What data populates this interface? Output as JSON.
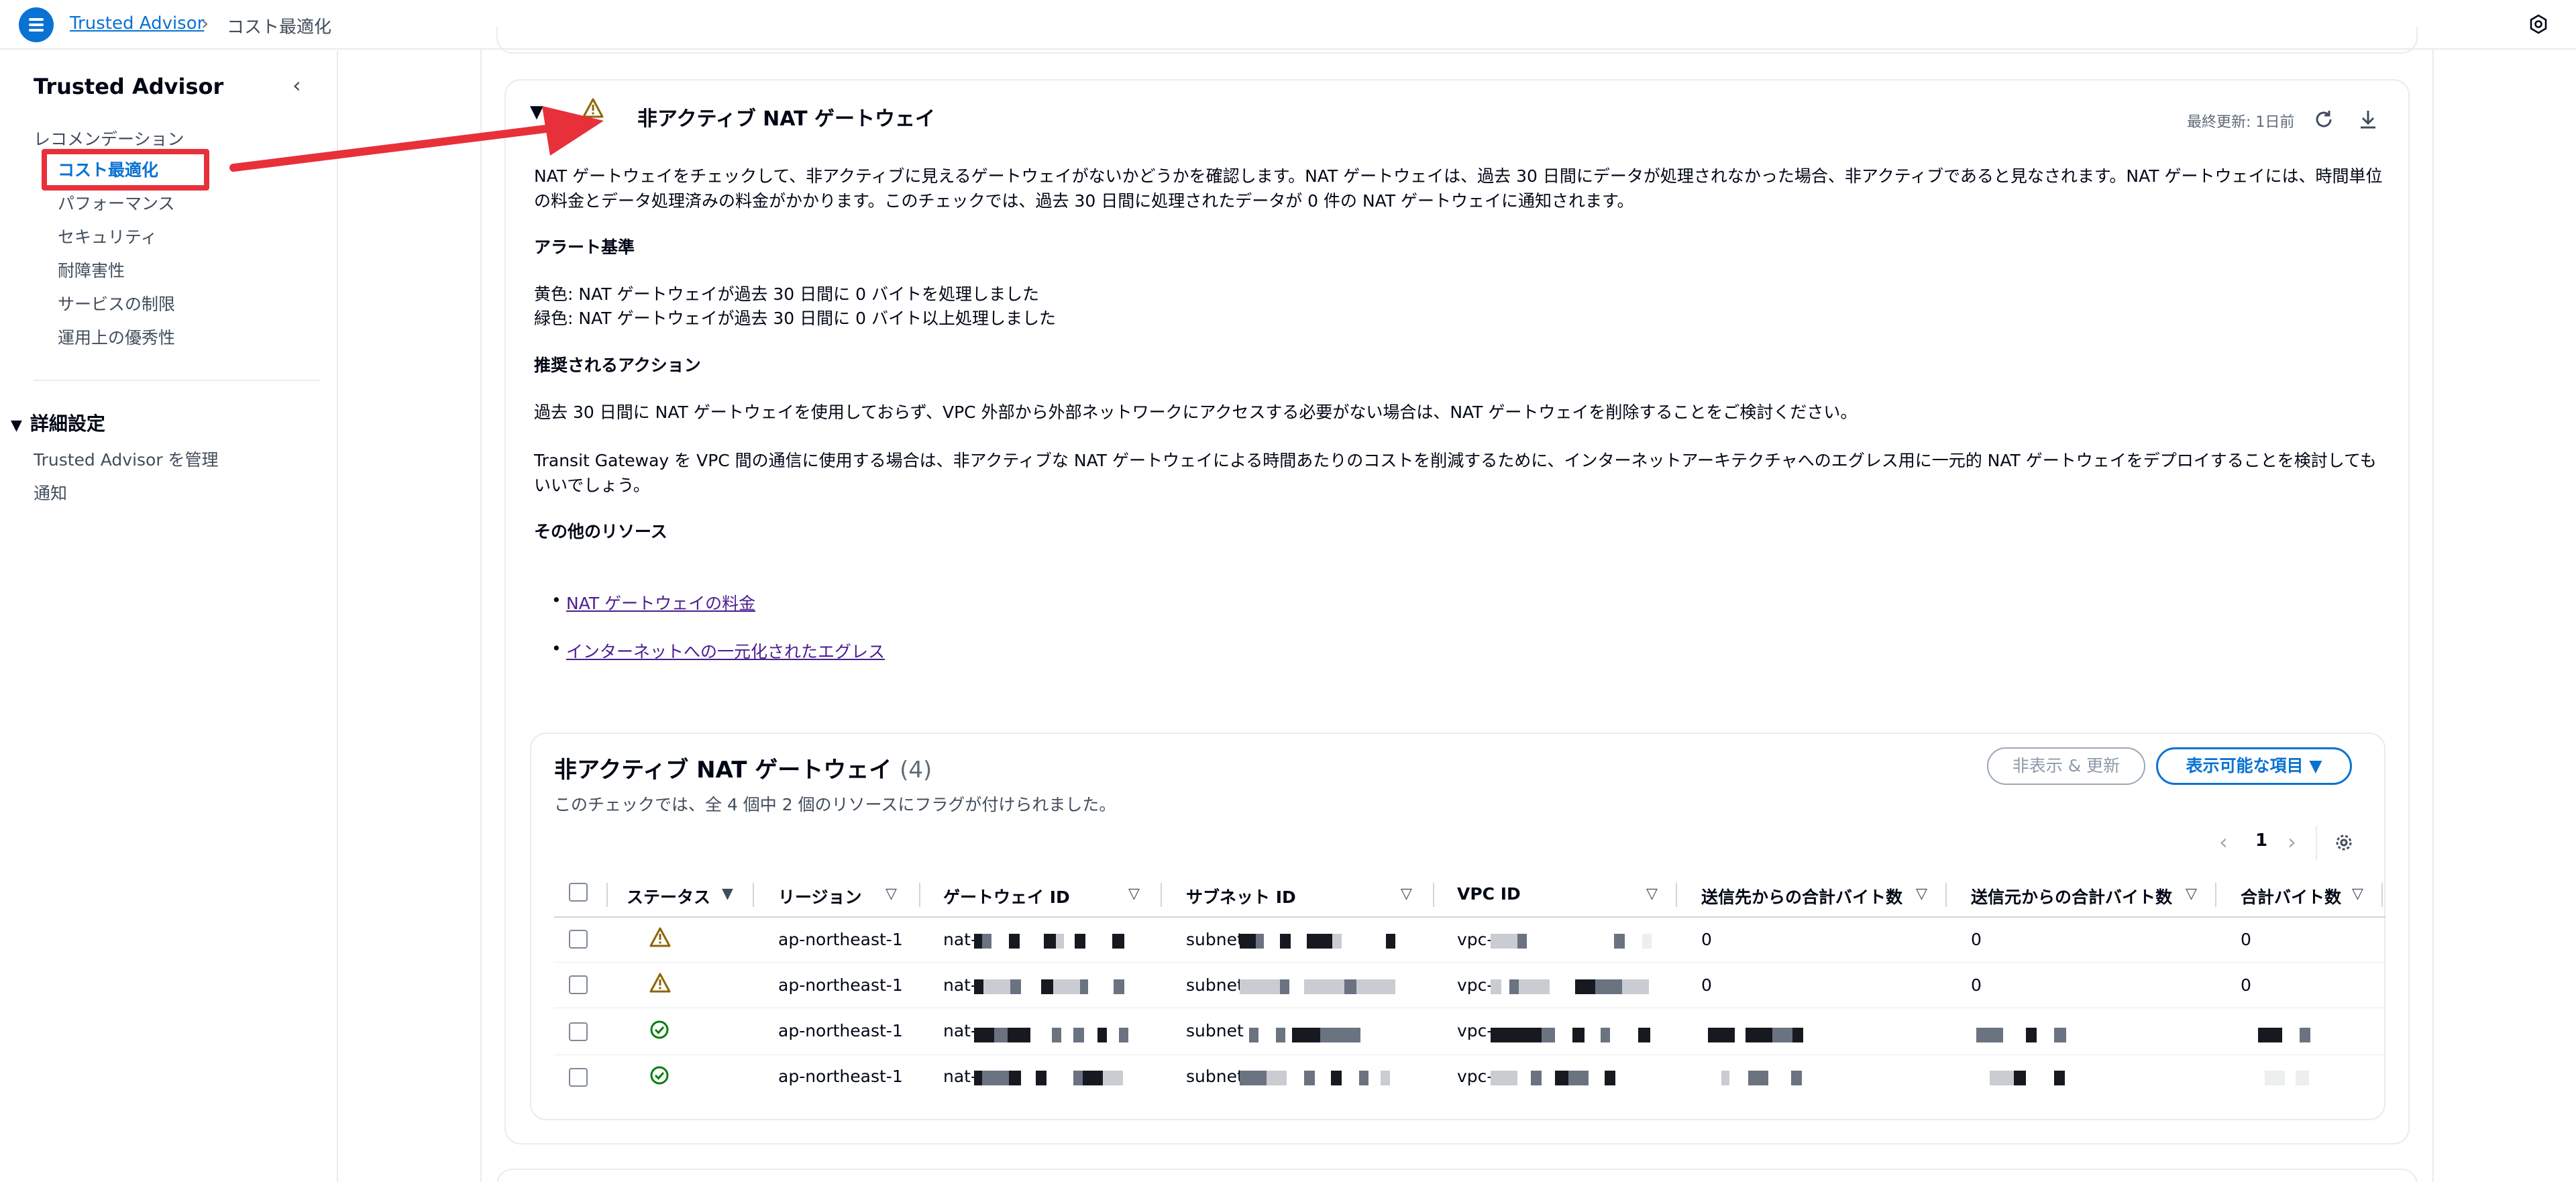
{
  "topbar": {
    "breadcrumb_root": "Trusted Advisor",
    "breadcrumb_current": "コスト最適化"
  },
  "sidebar": {
    "title": "Trusted Advisor",
    "group_label": "レコメンデーション",
    "items": [
      {
        "label": "コスト最適化",
        "active": true
      },
      {
        "label": "パフォーマンス"
      },
      {
        "label": "セキュリティ"
      },
      {
        "label": "耐障害性"
      },
      {
        "label": "サービスの制限"
      },
      {
        "label": "運用上の優秀性"
      }
    ],
    "section_title": "詳細設定",
    "sub_items": [
      "Trusted Advisor を管理",
      "通知"
    ]
  },
  "check": {
    "title": "非アクティブ NAT ゲートウェイ",
    "last_updated": "最終更新: 1日前",
    "description": "NAT ゲートウェイをチェックして、非アクティブに見えるゲートウェイがないかどうかを確認します。NAT ゲートウェイは、過去 30 日間にデータが処理されなかった場合、非アクティブであると見なされます。NAT ゲートウェイには、時間単位の料金とデータ処理済みの料金がかかります。このチェックでは、過去 30 日間に処理されたデータが 0 件の NAT ゲートウェイに通知されます。",
    "alert_heading": "アラート基準",
    "alert_yellow": "黄色: NAT ゲートウェイが過去 30 日間に 0 バイトを処理しました",
    "alert_green": "緑色: NAT ゲートウェイが過去 30 日間に 0 バイト以上処理しました",
    "action_heading": "推奨されるアクション",
    "action_1": "過去 30 日間に NAT ゲートウェイを使用しておらず、VPC 外部から外部ネットワークにアクセスする必要がない場合は、NAT ゲートウェイを削除することをご検討ください。",
    "action_2": "Transit Gateway を VPC 間の通信に使用する場合は、非アクティブな NAT ゲートウェイによる時間あたりのコストを削減するために、インターネットアーキテクチャへのエグレス用に一元的 NAT ゲートウェイをデプロイすることを検討してもいいでしょう。",
    "resources_heading": "その他のリソース",
    "links": [
      "NAT ゲートウェイの料金",
      "インターネットへの一元化されたエグレス"
    ]
  },
  "table": {
    "title": "非アクティブ NAT ゲートウェイ",
    "count": "(4)",
    "description": "このチェックでは、全 4 個中 2 個のリソースにフラグが付けられました。",
    "hide_button": "非表示 & 更新",
    "visible_button": "表示可能な項目",
    "page": "1",
    "columns": [
      "ステータス",
      "リージョン",
      "ゲートウェイ ID",
      "サブネット ID",
      "VPC ID",
      "送信先からの合計バイト数",
      "送信元からの合計バイト数",
      "合計バイト数"
    ],
    "rows": [
      {
        "status": "warning",
        "region": "ap-northeast-1",
        "gw": "nat-",
        "subnet": "subnet",
        "vpc": "vpc-",
        "dest": "0",
        "src": "0",
        "total": "0"
      },
      {
        "status": "warning",
        "region": "ap-northeast-1",
        "gw": "nat-",
        "subnet": "subnet",
        "vpc": "vpc-",
        "dest": "0",
        "src": "0",
        "total": "0"
      },
      {
        "status": "ok",
        "region": "ap-northeast-1",
        "gw": "nat-",
        "subnet": "subnet",
        "vpc": "vpc-",
        "dest": "",
        "src": "",
        "total": ""
      },
      {
        "status": "ok",
        "region": "ap-northeast-1",
        "gw": "nat-",
        "subnet": "subnet",
        "vpc": "vpc-",
        "dest": "",
        "src": "",
        "total": ""
      }
    ]
  },
  "colors": {
    "accent": "#0972d3",
    "warning": "#8d6605",
    "ok": "#037f0c",
    "annotation": "#e8303a"
  }
}
